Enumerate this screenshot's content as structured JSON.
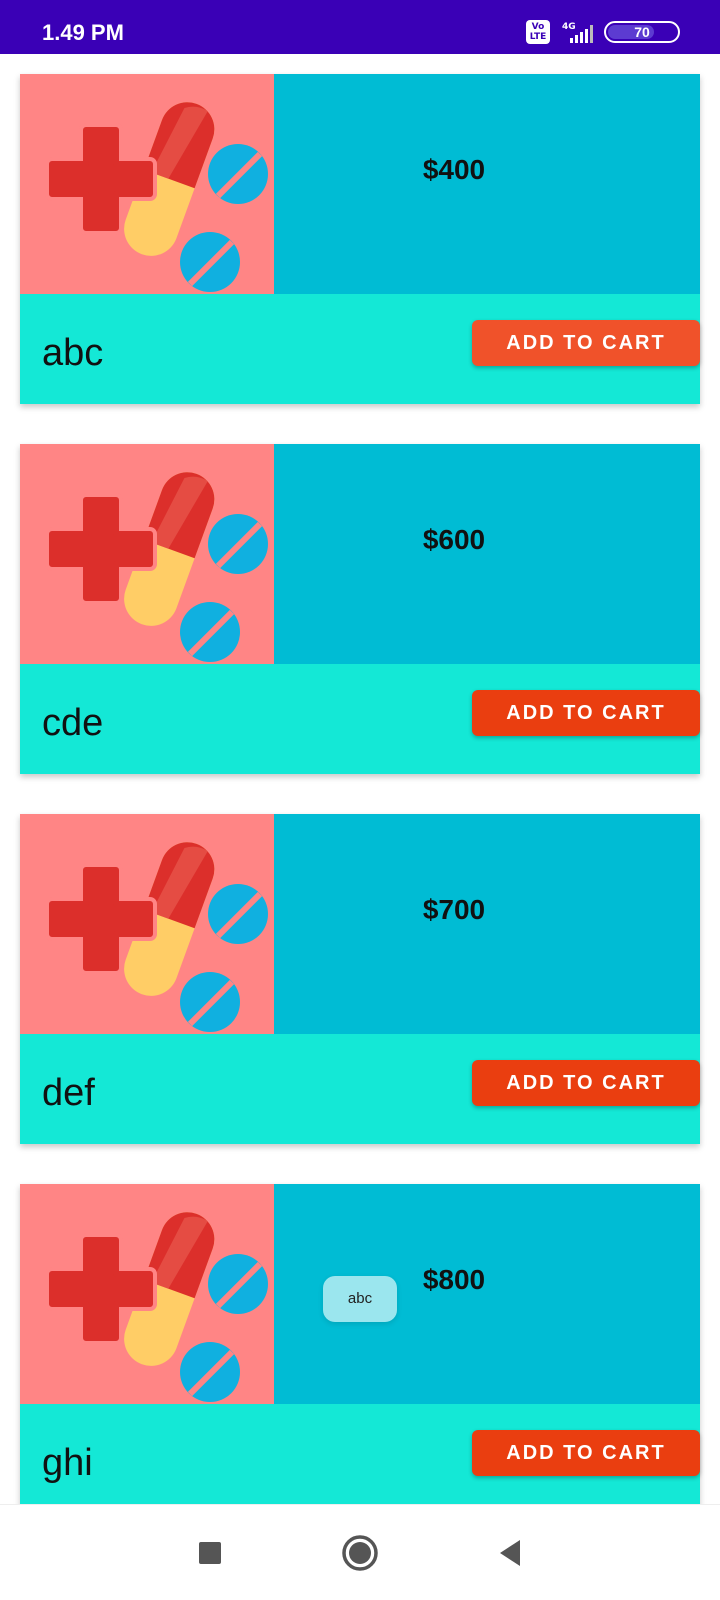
{
  "status_bar": {
    "time": "1.49 PM",
    "volte_label": "Vo LTE",
    "network_label": "4G",
    "battery_level": "70",
    "battery_fraction": 0.7,
    "background": "#3a00b6"
  },
  "products": [
    {
      "name": "abc",
      "price": "$400",
      "button_label": "ADD TO CART",
      "button_color": "#f0522a"
    },
    {
      "name": "cde",
      "price": "$600",
      "button_label": "ADD TO CART",
      "button_color": "#ea3e10"
    },
    {
      "name": "def",
      "price": "$700",
      "button_label": "ADD TO CART",
      "button_color": "#ea3e10"
    },
    {
      "name": "ghi",
      "price": "$800",
      "button_label": "ADD TO CART",
      "button_color": "#ea3e10"
    }
  ],
  "toast": {
    "text": "abc"
  },
  "colors": {
    "image_bg": "#ff8585",
    "price_panel": "#00bcd4",
    "card_bottom": "#14e8d6"
  },
  "icons": {
    "product_image": "medicine-pills-icon",
    "nav_recents": "square-icon",
    "nav_home": "circle-icon",
    "nav_back": "triangle-back-icon"
  }
}
